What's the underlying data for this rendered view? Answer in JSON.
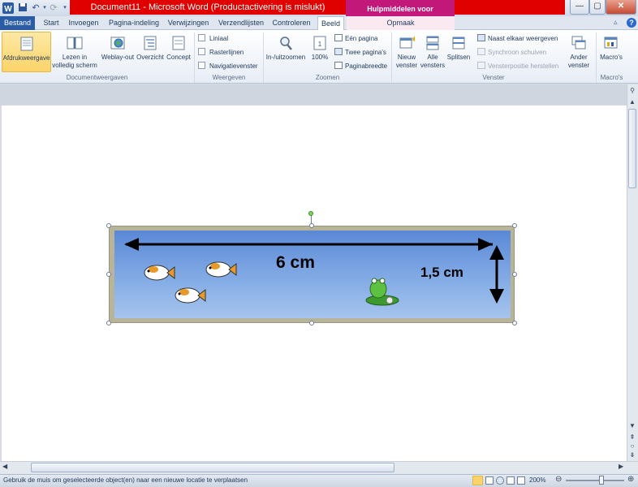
{
  "window": {
    "title": "Document11 - Microsoft Word (Productactivering is mislukt)",
    "context_header": "Hulpmiddelen voor afbeeldingen"
  },
  "tabs": [
    "Bestand",
    "Start",
    "Invoegen",
    "Pagina-indeling",
    "Verwijzingen",
    "Verzendlijsten",
    "Controleren",
    "Beeld",
    "Opmaak"
  ],
  "ribbon": {
    "documentweergaven": {
      "label": "Documentweergaven",
      "afdruk": "Afdrukweergave",
      "lezen1": "Lezen in",
      "lezen2": "volledig scherm",
      "weblay": "Weblay-out",
      "overzicht": "Overzicht",
      "concept": "Concept"
    },
    "weergeven": {
      "label": "Weergeven",
      "liniaal": "Liniaal",
      "rasterlijnen": "Rasterlijnen",
      "navigatie": "Navigatievenster"
    },
    "zoomen": {
      "label": "Zoomen",
      "zoom": "In-/uitzoomen",
      "pct": "100%",
      "een": "Eén pagina",
      "twee": "Twee pagina's",
      "breedte": "Paginabreedte"
    },
    "venster": {
      "label": "Venster",
      "nieuw1": "Nieuw",
      "nieuw2": "venster",
      "alle1": "Alle",
      "alle2": "vensters",
      "splitsen": "Splitsen",
      "naast": "Naast elkaar weergeven",
      "synchroon": "Synchroon schuiven",
      "positie": "Vensterpositie herstellen",
      "ander1": "Ander",
      "ander2": "venster"
    },
    "macros": {
      "label": "Macro's",
      "btn": "Macro's"
    }
  },
  "image": {
    "length_label": "6 cm",
    "width_label": "1,5 cm"
  },
  "status": {
    "text": "Gebruik de muis om geselecteerde object(en) naar een nieuwe locatie te verplaatsen",
    "zoom": "200%"
  },
  "colors": {
    "accent": "#2a5ca6",
    "context": "#c2187a",
    "title_bar_error": "#e00000"
  }
}
